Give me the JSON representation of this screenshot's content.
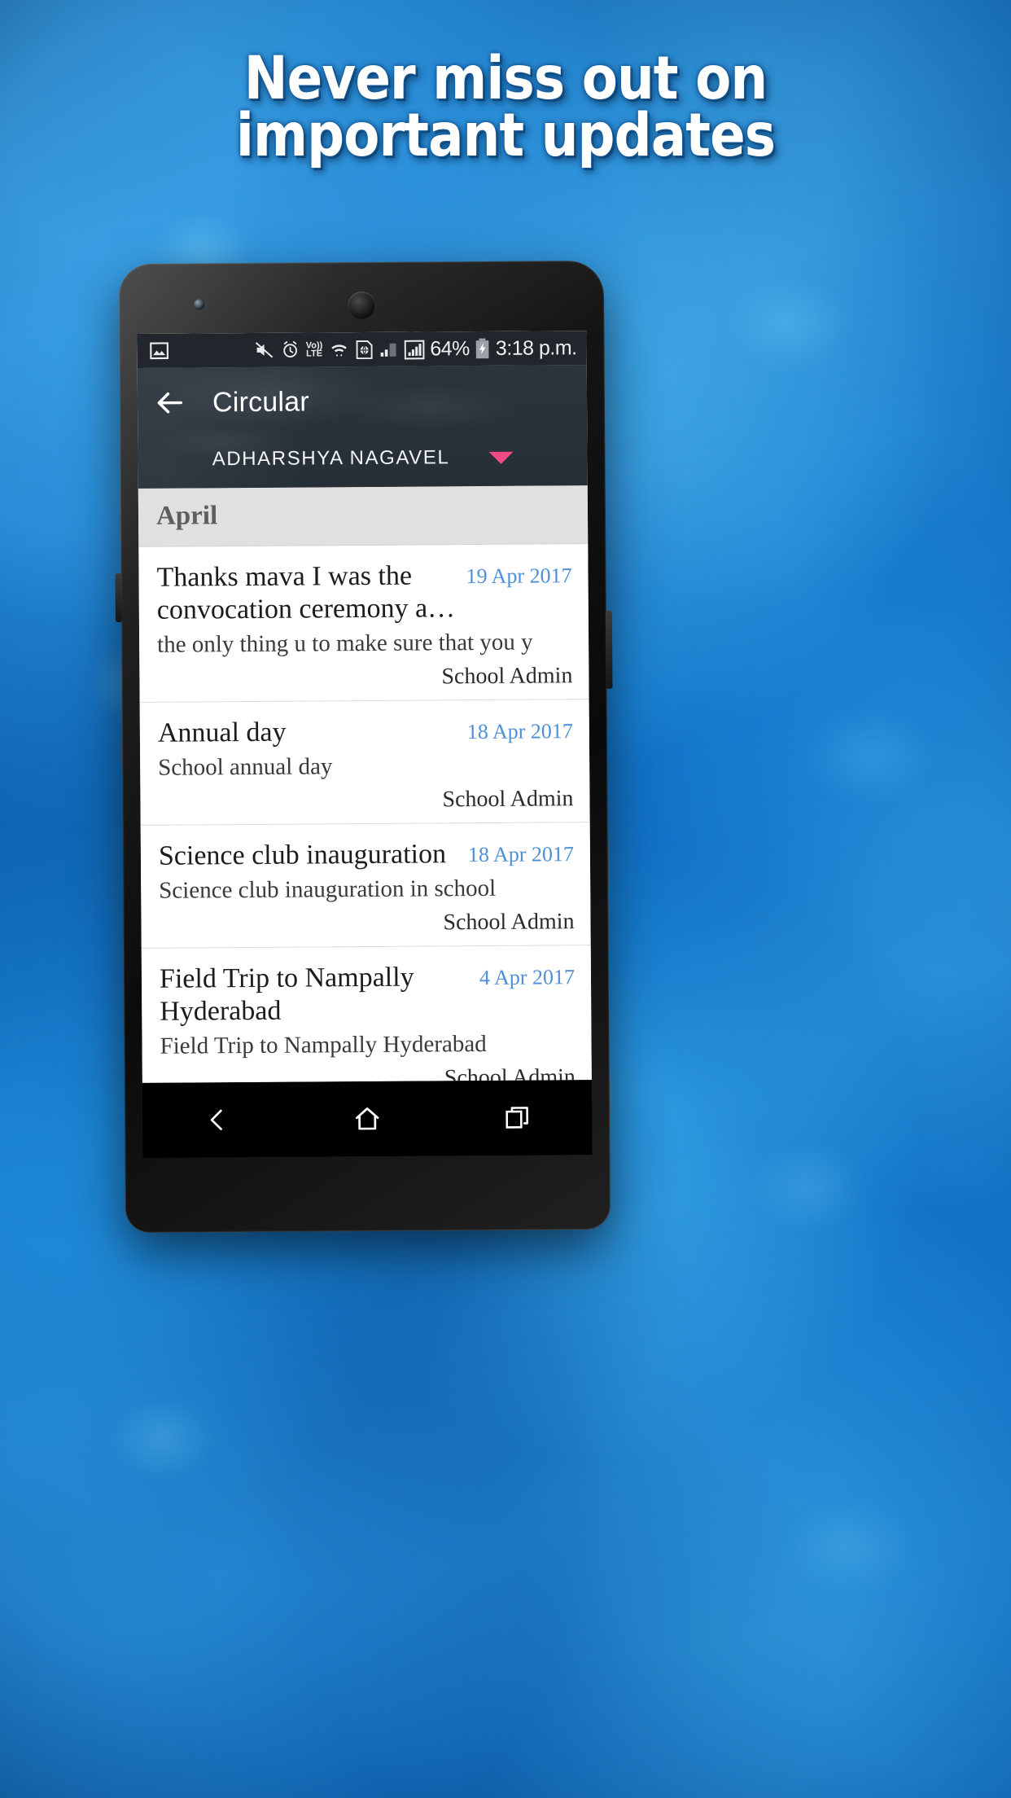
{
  "promo": {
    "headline_line1": "Never miss out on",
    "headline_line2": "important updates",
    "headline_color": "#ffffff",
    "background_color": "#0b6fc4"
  },
  "phone": {
    "status_bar": {
      "icons_left": [
        "image-icon"
      ],
      "icons_right": [
        "mute-icon",
        "alarm-icon",
        "volte-icon",
        "wifi-icon",
        "sim-globe-icon",
        "signal-weak-icon",
        "signal-full-icon"
      ],
      "volte_top": "Vo))",
      "volte_bottom": "LTE",
      "battery_percent": "64%",
      "battery_state": "charging",
      "time": "3:18 p.m.",
      "background_color": "#20262b"
    },
    "app_bar": {
      "back_icon": "back-arrow-icon",
      "title": "Circular",
      "student_name": "ADHARSHYA  NAGAVEL",
      "dropdown_icon": "chevron-down-icon",
      "dropdown_color": "#ef4a83",
      "background_color": "#2a333c"
    },
    "month_header": {
      "label": "April",
      "background_color": "#e0e0e0",
      "text_color": "#5e5e5e"
    },
    "circulars": [
      {
        "title": "Thanks mava I was the convocation ceremony a…",
        "date": "19 Apr 2017",
        "description": "the only thing u to make sure that you y",
        "author": "School Admin"
      },
      {
        "title": "Annual day",
        "date": "18 Apr 2017",
        "description": "School annual day",
        "author": "School Admin"
      },
      {
        "title": "Science club inauguration",
        "date": "18 Apr 2017",
        "description": "Science club inauguration in school",
        "author": "School Admin"
      },
      {
        "title": "Field Trip to Nampally Hyderabad",
        "date": "4 Apr 2017",
        "description": "Field Trip to Nampally Hyderabad",
        "author": "School Admin"
      }
    ],
    "nav_bar": {
      "back": "nav-back-icon",
      "home": "nav-home-icon",
      "recents": "nav-recents-icon",
      "background_color": "#000000"
    },
    "date_text_color": "#4f8fd6"
  }
}
